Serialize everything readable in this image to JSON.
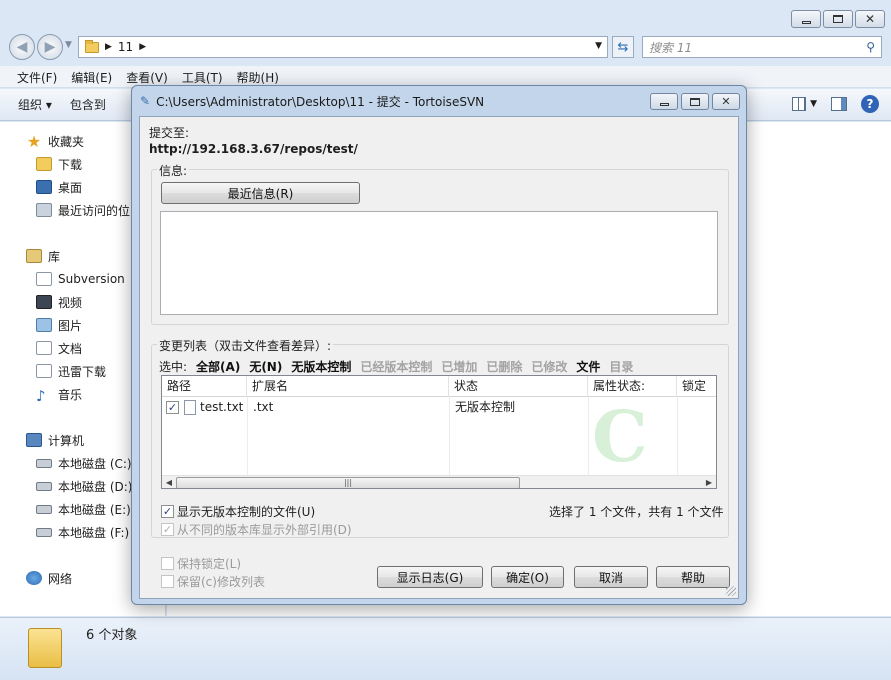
{
  "explorer": {
    "address_path": "11",
    "search_placeholder": "搜索 11",
    "menu": [
      "文件(F)",
      "编辑(E)",
      "查看(V)",
      "工具(T)",
      "帮助(H)"
    ],
    "toolbar": [
      "组织 ▾",
      "包含到"
    ],
    "nav": {
      "favorites": "收藏夹",
      "downloads": "下载",
      "desktop": "桌面",
      "recent": "最近访问的位",
      "libraries": "库",
      "subversion": "Subversion",
      "videos": "视频",
      "pictures": "图片",
      "documents": "文档",
      "thunder": "迅雷下载",
      "music": "音乐",
      "computer": "计算机",
      "drive_c": "本地磁盘 (C:)",
      "drive_d": "本地磁盘 (D:)",
      "drive_e": "本地磁盘 (E:)",
      "drive_f": "本地磁盘 (F:)",
      "network": "网络"
    },
    "status_count": "6 个对象"
  },
  "dialog": {
    "title": "C:\\Users\\Administrator\\Desktop\\11 - 提交 - TortoiseSVN",
    "commit_to_label": "提交至:",
    "commit_url": "http://192.168.3.67/repos/test/",
    "message_label": "信息:",
    "recent_msg_button": "最近信息(R)",
    "changes_label": "变更列表（双击文件查看差异）:",
    "select_label": "选中:",
    "filters": [
      {
        "label": "全部(A)",
        "enabled": true
      },
      {
        "label": "无(N)",
        "enabled": true
      },
      {
        "label": "无版本控制",
        "enabled": true
      },
      {
        "label": "已经版本控制",
        "enabled": false
      },
      {
        "label": "已增加",
        "enabled": false
      },
      {
        "label": "已删除",
        "enabled": false
      },
      {
        "label": "已修改",
        "enabled": false
      },
      {
        "label": "文件",
        "enabled": true
      },
      {
        "label": "目录",
        "enabled": false
      }
    ],
    "columns": [
      "路径",
      "扩展名",
      "状态",
      "属性状态:",
      "锁定"
    ],
    "rows": [
      {
        "checked": true,
        "path": "test.txt",
        "ext": ".txt",
        "status": "无版本控制",
        "prop_status": "",
        "lock": ""
      }
    ],
    "show_unversioned": "显示无版本控制的文件(U)",
    "show_externals": "从不同的版本库显示外部引用(D)",
    "selection_summary": "选择了 1 个文件，共有 1 个文件",
    "keep_locks": "保持锁定(L)",
    "keep_changelist": "保留(c)修改列表",
    "buttons": {
      "show_log": "显示日志(G)",
      "ok": "确定(O)",
      "cancel": "取消",
      "help": "帮助"
    }
  },
  "colors": {
    "explorer_bg": "#dce7f5",
    "dialog_frame": "#c3d5ea",
    "dialog_body": "#f0f0f0",
    "disabled_text": "#a3a3a3"
  }
}
